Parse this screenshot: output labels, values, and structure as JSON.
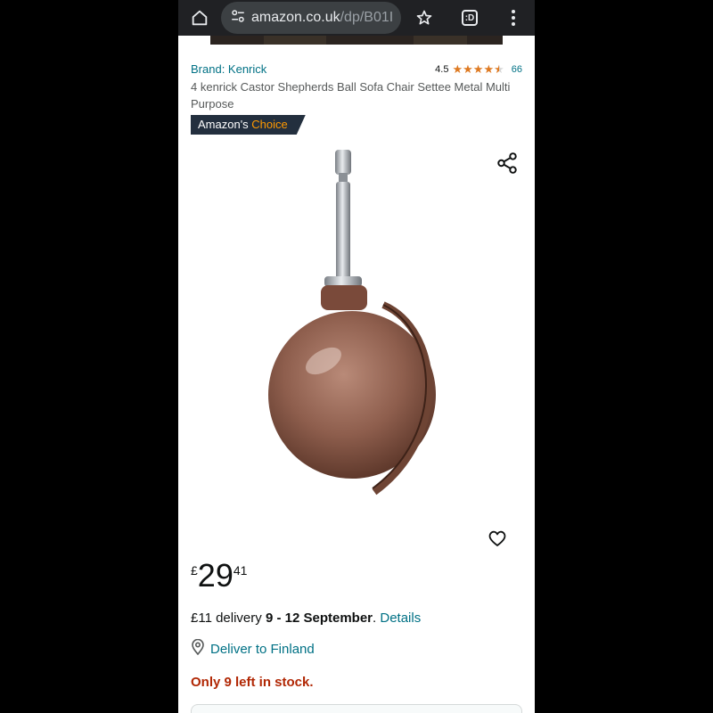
{
  "browser": {
    "url_host": "amazon.co.uk",
    "url_path": "/dp/B01I",
    "tab_count": ":D",
    "icons": [
      "home-icon",
      "site-settings-icon",
      "star-icon",
      "tab-switcher-icon",
      "more-vert-icon"
    ],
    "toolbar_color": "#202124"
  },
  "product": {
    "brand": "Brand: Kenrick",
    "rating": "4.5",
    "rating_value": 4.5,
    "review_count": "66",
    "title": "4 kenrick Castor Shepherds Ball Sofa Chair Settee Metal Multi Purpose",
    "badge_prefix": "Amazon's",
    "badge_highlight": "Choice",
    "price_symbol": "£",
    "price_whole": "29",
    "price_fraction": "41"
  },
  "delivery": {
    "prefix": "£11 delivery",
    "dates": "9 - 12 September",
    "period": ".",
    "details_link": "Details"
  },
  "location": {
    "label": "Deliver to Finland"
  },
  "stock": {
    "message": "Only 9 left in stock."
  },
  "colors": {
    "link": "#007185",
    "star": "#de7921",
    "stock": "#b12704",
    "badge_bg": "#232f3e",
    "badge_accent": "#ff9900"
  }
}
